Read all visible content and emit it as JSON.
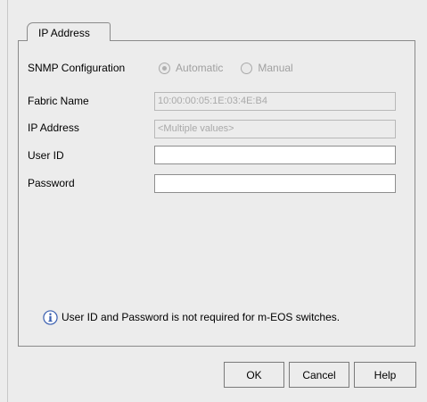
{
  "tab": {
    "label": "IP Address"
  },
  "form": {
    "snmp": {
      "label": "SNMP Configuration",
      "option_automatic": "Automatic",
      "option_manual": "Manual",
      "selected": "Automatic"
    },
    "fabric_name": {
      "label": "Fabric Name",
      "value": "10:00:00:05:1E:03:4E:B4"
    },
    "ip_address": {
      "label": "IP Address",
      "value": "<Multiple values>"
    },
    "user_id": {
      "label": "User ID",
      "value": ""
    },
    "password": {
      "label": "Password",
      "value": ""
    }
  },
  "info": {
    "icon": "info-icon",
    "message": "User ID and Password is not required for m-EOS switches."
  },
  "buttons": {
    "ok": "OK",
    "cancel": "Cancel",
    "help": "Help"
  },
  "colors": {
    "background": "#ececec",
    "border": "#8a8a8a",
    "disabled_text": "#a0a0a0",
    "info_icon": "#3a5fb0"
  }
}
